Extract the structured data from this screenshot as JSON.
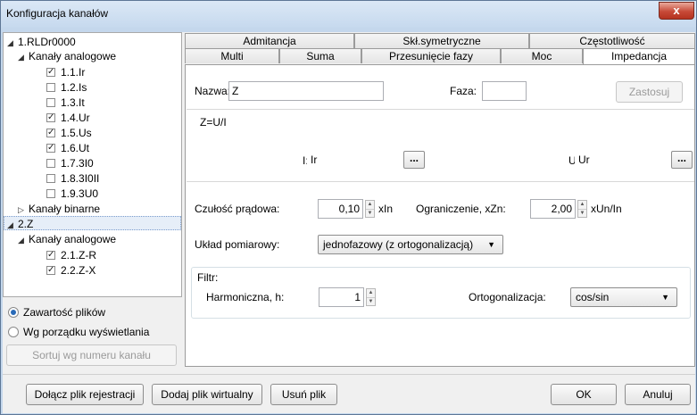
{
  "window": {
    "title": "Konfiguracja kanałów",
    "close_label": "x"
  },
  "tree": {
    "nodes": [
      {
        "label": "1.RLDr0000",
        "arrow": "◢",
        "check": null
      },
      {
        "label": "Kanały analogowe",
        "arrow": "◢",
        "check": null
      },
      {
        "label": "1.1.Ir",
        "check": true
      },
      {
        "label": "1.2.Is",
        "check": false
      },
      {
        "label": "1.3.It",
        "check": false
      },
      {
        "label": "1.4.Ur",
        "check": true
      },
      {
        "label": "1.5.Us",
        "check": true
      },
      {
        "label": "1.6.Ut",
        "check": true
      },
      {
        "label": "1.7.3I0",
        "check": false
      },
      {
        "label": "1.8.3I0II",
        "check": false
      },
      {
        "label": "1.9.3U0",
        "check": false
      },
      {
        "label": "Kanały binarne",
        "arrow": "▷",
        "check": null
      },
      {
        "label": "2.Z",
        "arrow": "◢",
        "check": null
      },
      {
        "label": "Kanały analogowe",
        "arrow": "◢",
        "check": null
      },
      {
        "label": "2.1.Z-R",
        "check": true
      },
      {
        "label": "2.2.Z-X",
        "check": true
      }
    ]
  },
  "sort_options": {
    "file_contents": "Zawartość plików",
    "display_order": "Wg porządku wyświetlania",
    "selected": "file_contents",
    "sort_button": "Sortuj wg numeru kanału"
  },
  "tabs": {
    "row1": [
      "Admitancja",
      "Skł.symetryczne",
      "Częstotliwość"
    ],
    "row2": [
      "Multi",
      "Suma",
      "Przesunięcie fazy",
      "Moc",
      "Impedancja"
    ],
    "active": "Impedancja"
  },
  "impedance": {
    "name_label": "Nazwa:",
    "name_value": "Z",
    "phase_label": "Faza:",
    "phase_value": "",
    "apply_button": "Zastosuj",
    "formula": "Z=U/I",
    "i_label": "I:",
    "i_value": "Ir",
    "u_label": "U:",
    "u_value": "Ur",
    "browse_label": "...",
    "current_sensitivity_label": "Czułość prądowa:",
    "current_sensitivity_value": "0,10",
    "current_sensitivity_unit": "xIn",
    "limit_label": "Ograniczenie, xZn:",
    "limit_value": "2,00",
    "limit_unit": "xUn/In",
    "measurement_label": "Układ pomiarowy:",
    "measurement_value": "jednofazowy (z ortogonalizacją)",
    "filter_label": "Filtr:",
    "harmonic_label": "Harmoniczna, h:",
    "harmonic_value": "1",
    "orthogonalization_label": "Ortogonalizacja:",
    "orthogonalization_value": "cos/sin"
  },
  "footer": {
    "attach_button": "Dołącz plik rejestracji",
    "add_virtual_button": "Dodaj plik wirtualny",
    "remove_button": "Usuń plik",
    "ok_button": "OK",
    "cancel_button": "Anuluj"
  }
}
